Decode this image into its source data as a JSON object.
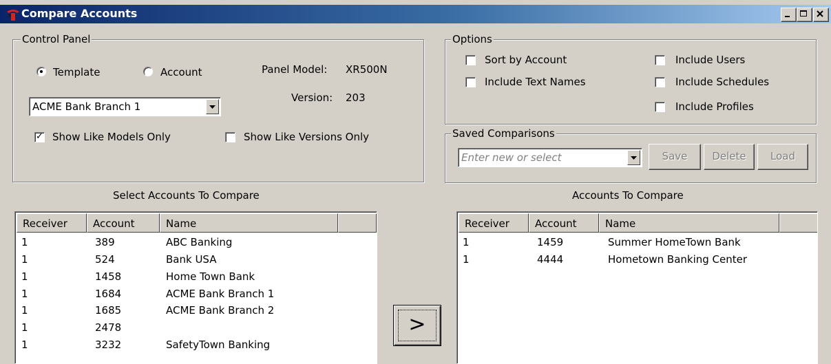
{
  "window": {
    "title": "Compare Accounts"
  },
  "control_panel": {
    "legend": "Control Panel",
    "radio_template": "Template",
    "radio_account": "Account",
    "selected_radio": "template",
    "panel_model_label": "Panel Model:",
    "panel_model_value": "XR500N",
    "version_label": "Version:",
    "version_value": "203",
    "template_combo_value": "ACME Bank Branch 1",
    "show_like_models_label": "Show Like Models Only",
    "show_like_models_checked": true,
    "show_like_versions_label": "Show Like Versions Only",
    "show_like_versions_checked": false
  },
  "options": {
    "legend": "Options",
    "sort_by_account": "Sort by Account",
    "include_text_names": "Include Text Names",
    "include_users": "Include Users",
    "include_schedules": "Include Schedules",
    "include_profiles": "Include Profiles"
  },
  "saved": {
    "legend": "Saved Comparisons",
    "placeholder": "Enter new or select",
    "save_label": "Save",
    "delete_label": "Delete",
    "load_label": "Load"
  },
  "left_list": {
    "title": "Select Accounts To Compare",
    "headers": [
      "Receiver",
      "Account",
      "Name"
    ],
    "rows": [
      [
        "1",
        "389",
        "ABC Banking"
      ],
      [
        "1",
        "524",
        "Bank USA"
      ],
      [
        "1",
        "1458",
        "Home Town Bank"
      ],
      [
        "1",
        "1684",
        "ACME Bank Branch 1"
      ],
      [
        "1",
        "1685",
        "ACME Bank Branch 2"
      ],
      [
        "1",
        "2478",
        ""
      ],
      [
        "1",
        "3232",
        "SafetyTown Banking"
      ]
    ]
  },
  "right_list": {
    "title": "Accounts To Compare",
    "headers": [
      "Receiver",
      "Account",
      "Name"
    ],
    "rows": [
      [
        "1",
        "1459",
        "Summer HomeTown Bank"
      ],
      [
        "1",
        "4444",
        "Hometown Banking Center"
      ]
    ]
  },
  "move_button": {
    "label": ">"
  },
  "icons": {
    "app": "app-logo-icon",
    "minimize": "minimize-icon",
    "maximize": "maximize-icon",
    "close": "close-icon",
    "dropdown": "dropdown-arrow-icon"
  }
}
